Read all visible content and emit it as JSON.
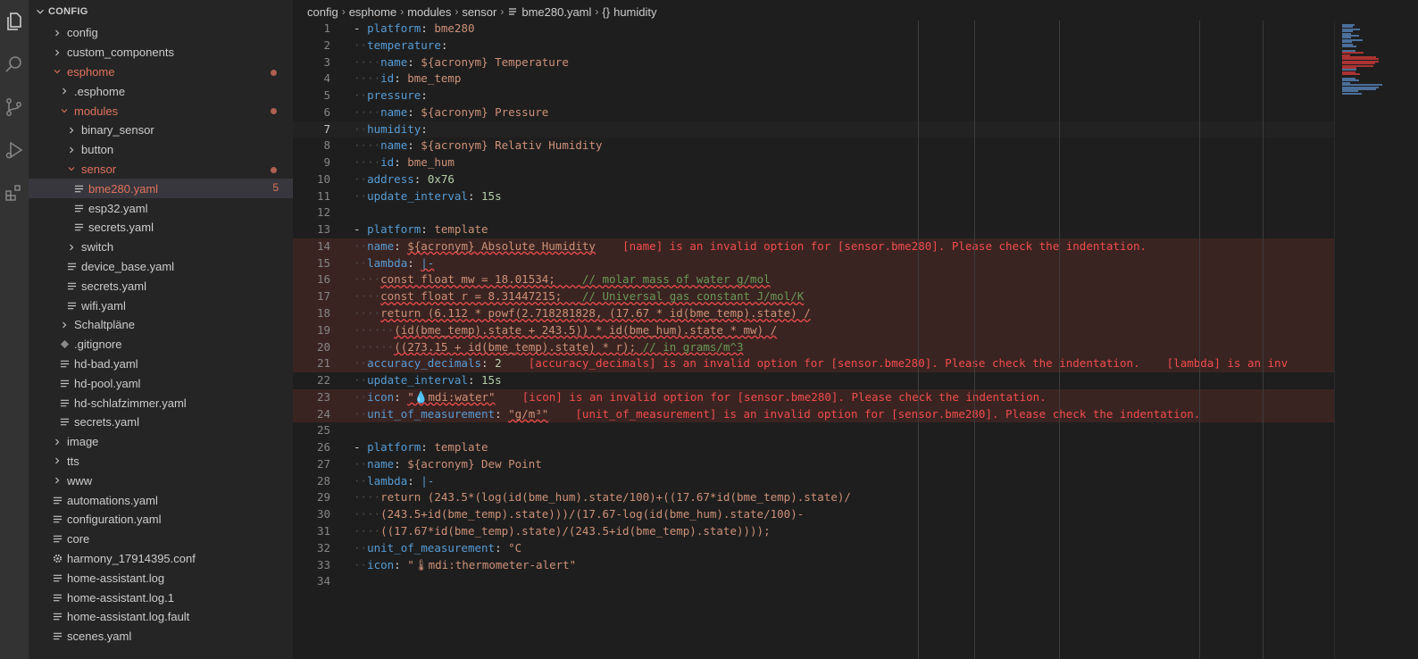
{
  "explorer": {
    "title": "CONFIG",
    "items": [
      {
        "label": "config",
        "depth": 0,
        "type": "folder",
        "open": false,
        "modified": false
      },
      {
        "label": "custom_components",
        "depth": 0,
        "type": "folder",
        "open": false,
        "modified": false
      },
      {
        "label": "esphome",
        "depth": 0,
        "type": "folder",
        "open": true,
        "modified": true
      },
      {
        "label": ".esphome",
        "depth": 1,
        "type": "folder",
        "open": false,
        "modified": false
      },
      {
        "label": "modules",
        "depth": 1,
        "type": "folder",
        "open": true,
        "modified": true
      },
      {
        "label": "binary_sensor",
        "depth": 2,
        "type": "folder",
        "open": false,
        "modified": false
      },
      {
        "label": "button",
        "depth": 2,
        "type": "folder",
        "open": false,
        "modified": false
      },
      {
        "label": "sensor",
        "depth": 2,
        "type": "folder",
        "open": true,
        "modified": true
      },
      {
        "label": "bme280.yaml",
        "depth": 3,
        "type": "file",
        "modified": true,
        "selected": true,
        "count": "5"
      },
      {
        "label": "esp32.yaml",
        "depth": 3,
        "type": "file",
        "modified": false
      },
      {
        "label": "secrets.yaml",
        "depth": 3,
        "type": "file",
        "modified": false
      },
      {
        "label": "switch",
        "depth": 2,
        "type": "folder",
        "open": false,
        "modified": false
      },
      {
        "label": "device_base.yaml",
        "depth": 2,
        "type": "file",
        "modified": false
      },
      {
        "label": "secrets.yaml",
        "depth": 2,
        "type": "file",
        "modified": false
      },
      {
        "label": "wifi.yaml",
        "depth": 2,
        "type": "file",
        "modified": false
      },
      {
        "label": "Schaltpläne",
        "depth": 1,
        "type": "folder",
        "open": false,
        "modified": false
      },
      {
        "label": ".gitignore",
        "depth": 1,
        "type": "gitfile",
        "modified": false
      },
      {
        "label": "hd-bad.yaml",
        "depth": 1,
        "type": "file",
        "modified": false
      },
      {
        "label": "hd-pool.yaml",
        "depth": 1,
        "type": "file",
        "modified": false
      },
      {
        "label": "hd-schlafzimmer.yaml",
        "depth": 1,
        "type": "file",
        "modified": false
      },
      {
        "label": "secrets.yaml",
        "depth": 1,
        "type": "file",
        "modified": false
      },
      {
        "label": "image",
        "depth": 0,
        "type": "folder",
        "open": false,
        "modified": false
      },
      {
        "label": "tts",
        "depth": 0,
        "type": "folder",
        "open": false,
        "modified": false
      },
      {
        "label": "www",
        "depth": 0,
        "type": "folder",
        "open": false,
        "modified": false
      },
      {
        "label": "automations.yaml",
        "depth": 0,
        "type": "file",
        "modified": false
      },
      {
        "label": "configuration.yaml",
        "depth": 0,
        "type": "file",
        "modified": false
      },
      {
        "label": "core",
        "depth": 0,
        "type": "file",
        "modified": false
      },
      {
        "label": "harmony_17914395.conf",
        "depth": 0,
        "type": "gear",
        "modified": false
      },
      {
        "label": "home-assistant.log",
        "depth": 0,
        "type": "file",
        "modified": false
      },
      {
        "label": "home-assistant.log.1",
        "depth": 0,
        "type": "file",
        "modified": false
      },
      {
        "label": "home-assistant.log.fault",
        "depth": 0,
        "type": "file",
        "modified": false
      },
      {
        "label": "scenes.yaml",
        "depth": 0,
        "type": "file",
        "modified": false
      }
    ]
  },
  "breadcrumbs": {
    "c1": "config",
    "c2": "esphome",
    "c3": "modules",
    "c4": "sensor",
    "c5": "bme280.yaml",
    "c6": "humidity"
  },
  "editor": {
    "current_line": 7,
    "lines": [
      {
        "n": "1",
        "ind": 0,
        "dash": true,
        "key": "platform",
        "val": "bme280"
      },
      {
        "n": "2",
        "ind": 0,
        "key": "temperature"
      },
      {
        "n": "3",
        "ind": 1,
        "key": "name",
        "val": "${acronym} Temperature"
      },
      {
        "n": "4",
        "ind": 1,
        "key": "id",
        "val": "bme_temp"
      },
      {
        "n": "5",
        "ind": 0,
        "key": "pressure"
      },
      {
        "n": "6",
        "ind": 1,
        "key": "name",
        "val": "${acronym} Pressure"
      },
      {
        "n": "7",
        "ind": 0,
        "key": "humidity"
      },
      {
        "n": "8",
        "ind": 1,
        "key": "name",
        "val": "${acronym} Relativ Humidity"
      },
      {
        "n": "9",
        "ind": 1,
        "key": "id",
        "val": "bme_hum"
      },
      {
        "n": "10",
        "ind": 0,
        "key": "address",
        "num": "0x76"
      },
      {
        "n": "11",
        "ind": 0,
        "key": "update_interval",
        "num": "15s"
      },
      {
        "n": "12",
        "blank": true
      },
      {
        "n": "13",
        "ind": 0,
        "dash": true,
        "key": "platform",
        "val": "template"
      },
      {
        "n": "14",
        "ind": 0,
        "key": "name",
        "val": "${acronym} Absolute Humidity",
        "err": true,
        "msg": "[name] is an invalid option for [sensor.bme280]. Please check the indentation."
      },
      {
        "n": "15",
        "ind": 0,
        "key": "lambda",
        "sym": "|-",
        "err": true
      },
      {
        "n": "16",
        "ind": 1,
        "raw": "const float mw = 18.01534;    // molar mass of water g/mol",
        "err": true
      },
      {
        "n": "17",
        "ind": 1,
        "raw": "const float r = 8.31447215;   // Universal gas constant J/mol/K",
        "err": true
      },
      {
        "n": "18",
        "ind": 1,
        "raw": "return (6.112 * powf(2.718281828, (17.67 * id(bme_temp).state) /",
        "err": true
      },
      {
        "n": "19",
        "ind": 2,
        "raw": "(id(bme_temp).state + 243.5)) * id(bme_hum).state * mw) /",
        "err": true
      },
      {
        "n": "20",
        "ind": 2,
        "raw": "((273.15 + id(bme_temp).state) * r); // in grams/m^3",
        "err": true
      },
      {
        "n": "21",
        "ind": 0,
        "key": "accuracy_decimals",
        "num": "2",
        "err": true,
        "msg": "[accuracy_decimals] is an invalid option for [sensor.bme280]. Please check the indentation.    [lambda] is an inv"
      },
      {
        "n": "22",
        "ind": 0,
        "key": "update_interval",
        "num": "15s"
      },
      {
        "n": "23",
        "ind": 0,
        "key": "icon",
        "val": "\"💧mdi:water\"",
        "err": true,
        "msg": "[icon] is an invalid option for [sensor.bme280]. Please check the indentation."
      },
      {
        "n": "24",
        "ind": 0,
        "key": "unit_of_measurement",
        "val": "\"g/m³\"",
        "err": true,
        "msg": "[unit_of_measurement] is an invalid option for [sensor.bme280]. Please check the indentation."
      },
      {
        "n": "25",
        "blank": true
      },
      {
        "n": "26",
        "ind": 0,
        "dash": true,
        "key": "platform",
        "val": "template"
      },
      {
        "n": "27",
        "ind": 0,
        "key": "name",
        "val": "${acronym} Dew Point"
      },
      {
        "n": "28",
        "ind": 0,
        "key": "lambda",
        "sym": "|-"
      },
      {
        "n": "29",
        "ind": 1,
        "raw": "return (243.5*(log(id(bme_hum).state/100)+((17.67*id(bme_temp).state)/"
      },
      {
        "n": "30",
        "ind": 1,
        "raw": "(243.5+id(bme_temp).state)))/(17.67-log(id(bme_hum).state/100)-"
      },
      {
        "n": "31",
        "ind": 1,
        "raw": "((17.67*id(bme_temp).state)/(243.5+id(bme_temp).state))));"
      },
      {
        "n": "32",
        "ind": 0,
        "key": "unit_of_measurement",
        "val": "°C"
      },
      {
        "n": "33",
        "ind": 0,
        "key": "icon",
        "val": "\"🌡mdi:thermometer-alert\""
      },
      {
        "n": "34",
        "blank": true
      }
    ]
  },
  "colors": {
    "keyword": "#569cd6",
    "string": "#ce9178",
    "number": "#b5cea8",
    "error": "#f14c4c",
    "modified": "#e2725b"
  }
}
